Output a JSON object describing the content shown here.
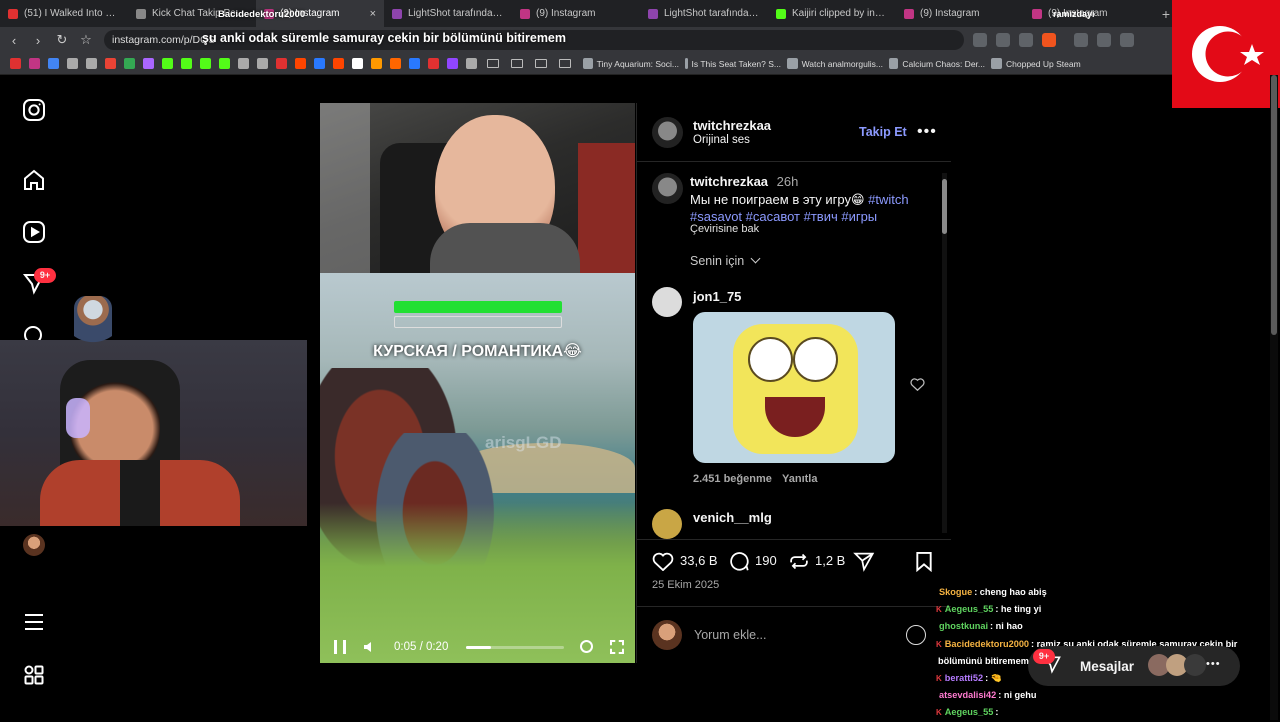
{
  "browser": {
    "tabs": [
      {
        "title": "(51) I Walked Into a Snow",
        "fav": "#e03131"
      },
      {
        "title": "Kick Chat Takip Penceresi",
        "fav": "#888888"
      },
      {
        "title": "(9) Instagram",
        "fav": "#c13584",
        "active": true
      },
      {
        "title": "LightShot tarafından Ekran",
        "fav": "#8e44ad"
      },
      {
        "title": "(9) Instagram",
        "fav": "#c13584"
      },
      {
        "title": "LightShot tarafından Ekran",
        "fav": "#8e44ad"
      },
      {
        "title": "Kaijiri clipped by insanaz",
        "fav": "#53fc18"
      },
      {
        "title": "(9) Instagram",
        "fav": "#c13584"
      },
      {
        "title": "(9) Instagram",
        "fav": "#c13584"
      }
    ],
    "url": "instagram.com/p/DQS",
    "bookmarks": [
      {
        "title": "Tiny Aquarium: Soci..."
      },
      {
        "title": "Is This Seat Taken? S..."
      },
      {
        "title": "Watch analmorgulis..."
      },
      {
        "title": "Calcium Chaos: Der..."
      },
      {
        "title": "Chopped Up Steam"
      }
    ],
    "bookmark_icon_colors": [
      "#e03131",
      "#c13584",
      "#4285f4",
      "#aaaaaa",
      "#aaaaaa",
      "#ea4335",
      "#34a853",
      "#aa66ff",
      "#53fc18",
      "#53fc18",
      "#53fc18",
      "#53fc18",
      "#aaaaaa",
      "#aaaaaa",
      "#e03131",
      "#ff4500",
      "#2979ff",
      "#ff4500",
      "#ffffff",
      "#ff9900",
      "#ff6600",
      "#2979ff",
      "#e03131",
      "#9146ff",
      "#aaaaaa"
    ]
  },
  "overlay": {
    "caption": "şu anki odak süremle samuray cekin bir bölümünü bitiremem",
    "streamer_name": "Bacidedektoru2000",
    "right_username": "ramizdayi"
  },
  "sidebar": {
    "notification_badge": "9+"
  },
  "post": {
    "author": "twitchrezkaa",
    "audio": "Orijinal ses",
    "follow_label": "Takip Et",
    "caption_author": "twitchrezkaa",
    "caption_time": "26h",
    "caption_text": "Мы не поиграем в эту игру😁",
    "caption_tag_1": "#twitch",
    "caption_tags_2": "#sasavot #сасавот #твич #игры",
    "translate": "Çevirisine bak",
    "sort_label": "Senin için",
    "comments": [
      {
        "user": "jon1_75",
        "likes": "2.451 beğenme",
        "reply": "Yanıtla"
      },
      {
        "user": "venich__mlg"
      }
    ],
    "likes": "33,6 B",
    "comment_count": "190",
    "reposts": "1,2 B",
    "date": "25 Ekim 2025",
    "comment_placeholder": "Yorum ekle...",
    "video_time": "0:05 / 0:20",
    "video_progress": 0.25,
    "game_caption": "КУРСКАЯ / РОМАНТИКА😂",
    "watermark": "arisgLGD"
  },
  "chat": [
    {
      "user": "Skogue",
      "color": "#f5b342",
      "msg": ": cheng hao abiş",
      "kick": false
    },
    {
      "user": "Aegeus_55",
      "color": "#5fd35f",
      "msg": ": he ting yi",
      "kick": true
    },
    {
      "user": "ghostkunai",
      "color": "#5fd35f",
      "msg": ": ni hao",
      "kick": false
    },
    {
      "user": "Bacidedektoru2000",
      "color": "#f5b342",
      "msg": ": ramiz şu anki odak süremle samuray cekin bir",
      "kick": true
    },
    {
      "user": "",
      "color": "#ffffff",
      "msg": "bölümünü bitiremem",
      "kick": false
    },
    {
      "user": "beratti52",
      "color": "#b57bff",
      "msg": ": 🤏",
      "kick": true
    },
    {
      "user": "atsevdalisi42",
      "color": "#ff7bd0",
      "msg": ": ni gehu",
      "kick": false
    },
    {
      "user": "Aegeus_55",
      "color": "#5fd35f",
      "msg": ":",
      "kick": true
    }
  ],
  "messages": {
    "label": "Mesajlar",
    "badge": "9+"
  }
}
